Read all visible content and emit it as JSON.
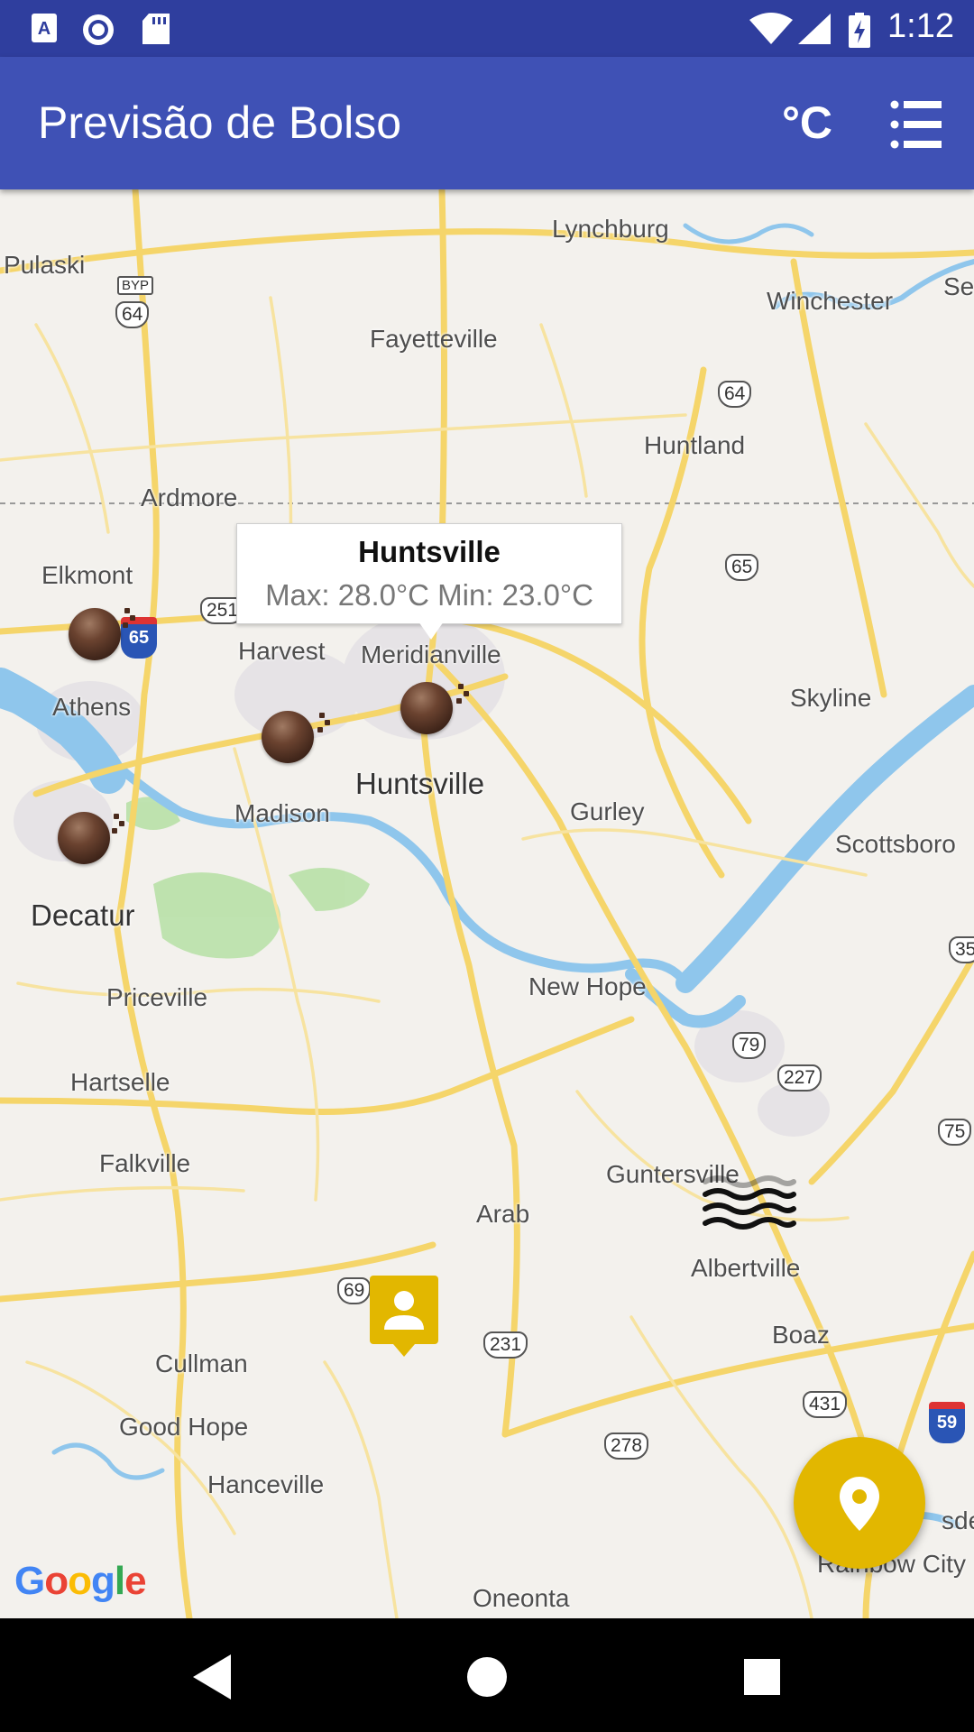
{
  "status_bar": {
    "time": "1:12",
    "icons": [
      "a-font-icon",
      "record-icon",
      "sd-card-icon",
      "wifi-icon",
      "cell-signal-icon",
      "battery-charging-icon"
    ]
  },
  "app_bar": {
    "title": "Previsão de Bolso",
    "unit_toggle_label": "°C",
    "list_icon": "list-icon"
  },
  "info_window": {
    "title": "Huntsville",
    "body": "Max: 28.0°C  Min: 23.0°C"
  },
  "map": {
    "places": [
      "Lynchburg",
      "Pulaski",
      "Winchester",
      "Se",
      "Fayetteville",
      "Huntland",
      "Ardmore",
      "Elkmont",
      "Harvest",
      "Meridianville",
      "Athens",
      "Skyline",
      "Madison",
      "Huntsville",
      "Gurley",
      "Scottsboro",
      "Decatur",
      "Priceville",
      "New Hope",
      "Hartselle",
      "Falkville",
      "Guntersville",
      "Arab",
      "Albertville",
      "Boaz",
      "Cullman",
      "Good Hope",
      "Hanceville",
      "Oneonta",
      "Rainbow City",
      "sder"
    ],
    "shields": [
      "BYP",
      "64",
      "64",
      "65",
      "251",
      "79",
      "227",
      "35",
      "75",
      "69",
      "231",
      "431",
      "278"
    ],
    "interstates": [
      "65",
      "59"
    ],
    "logo": "Google",
    "weather_markers": [
      "clear-night-icon",
      "clear-night-icon",
      "clear-night-icon",
      "clear-night-icon"
    ],
    "wind_marker": "windy-icon",
    "user_marker": "person-pin-icon"
  },
  "fab": {
    "icon": "location-pin-icon"
  },
  "nav_bar": {
    "icons": [
      "back-icon",
      "home-icon",
      "recents-icon"
    ]
  },
  "colors": {
    "status_bar": "#2f3e9e",
    "app_bar": "#3f51b5",
    "accent": "#e2b700",
    "map_bg": "#f3f1ed",
    "road": "#f6d86b",
    "water": "#8fc6ec",
    "park": "#a8dc9a"
  }
}
